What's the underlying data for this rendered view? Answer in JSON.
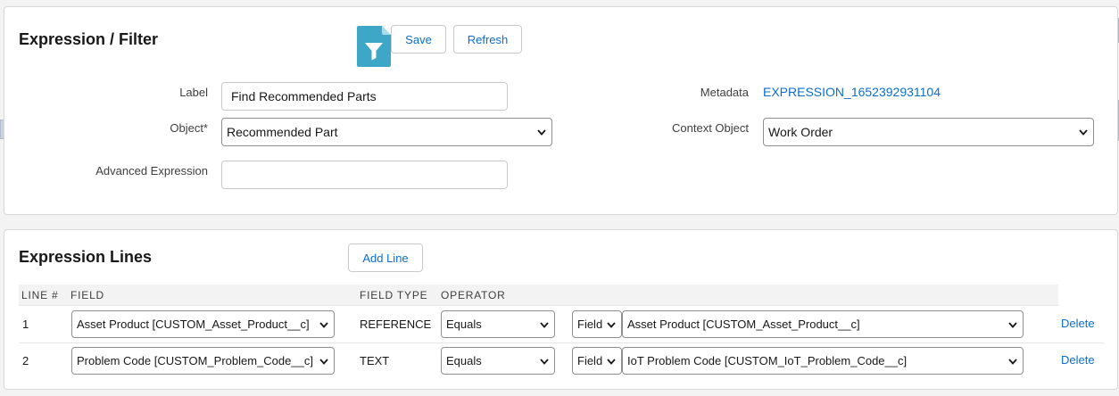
{
  "filter_card": {
    "title": "Expression / Filter",
    "save_label": "Save",
    "refresh_label": "Refresh",
    "label_caption": "Label",
    "label_value": "Find Recommended Parts",
    "object_caption": "Object*",
    "object_value": "Recommended Part",
    "advanced_caption": "Advanced Expression",
    "advanced_value": "",
    "metadata_caption": "Metadata",
    "metadata_value": "EXPRESSION_1652392931104",
    "context_caption": "Context Object",
    "context_value": "Work Order"
  },
  "lines_card": {
    "title": "Expression Lines",
    "add_line_label": "Add Line",
    "columns": [
      "LINE #",
      "FIELD",
      "FIELD TYPE",
      "OPERATOR"
    ],
    "rows": [
      {
        "line": "1",
        "field": "Asset Product [CUSTOM_Asset_Product__c]",
        "field_type": "REFERENCE",
        "operator": "Equals",
        "value_type": "Field",
        "value": "Asset Product [CUSTOM_Asset_Product__c]",
        "delete_label": "Delete"
      },
      {
        "line": "2",
        "field": "Problem Code [CUSTOM_Problem_Code__c]",
        "field_type": "TEXT",
        "operator": "Equals",
        "value_type": "Field",
        "value": "IoT Problem Code [CUSTOM_IoT_Problem_Code__c]",
        "delete_label": "Delete"
      }
    ]
  },
  "icons": {
    "filter_file": "filter-file-icon",
    "chevron": "chevron-down-icon"
  },
  "colors": {
    "accent": "#0b6ecf",
    "icon_bg": "#3ea6c7",
    "page_bg": "#f3f3f3"
  }
}
